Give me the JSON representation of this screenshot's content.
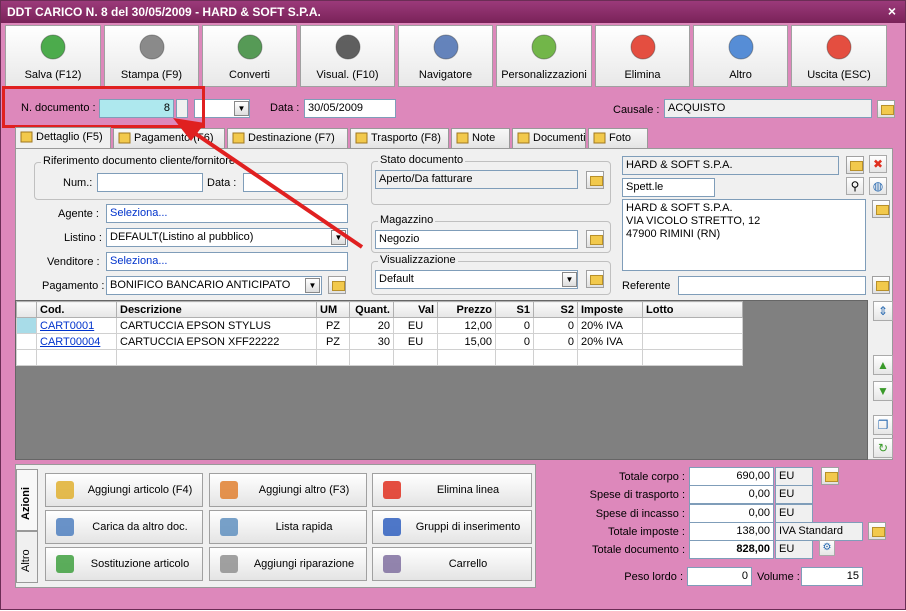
{
  "window": {
    "title": "DDT CARICO N. 8 del 30/05/2009 - HARD & SOFT S.P.A.",
    "close": "×"
  },
  "toolbar": [
    {
      "label": "Salva (F12)",
      "icon": "check-icon",
      "color": "#2e9e2e"
    },
    {
      "label": "Stampa (F9)",
      "icon": "printer-icon",
      "color": "#777777"
    },
    {
      "label": "Converti",
      "icon": "convert-icon",
      "color": "#3a8a3a"
    },
    {
      "label": "Visual. (F10)",
      "icon": "magic-wand-icon",
      "color": "#444444"
    },
    {
      "label": "Navigatore",
      "icon": "compass-icon",
      "color": "#4a6fb0"
    },
    {
      "label": "Personalizzazioni",
      "icon": "puzzle-icon",
      "color": "#5aaa2a"
    },
    {
      "label": "Elimina",
      "icon": "delete-x-icon",
      "color": "#e03020"
    },
    {
      "label": "Altro",
      "icon": "magnifier-icon",
      "color": "#3a7ad0"
    },
    {
      "label": "Uscita (ESC)",
      "icon": "power-icon",
      "color": "#e03020"
    }
  ],
  "header": {
    "ndoc_label": "N. documento :",
    "ndoc_value": "8",
    "data_label": "Data :",
    "data_value": "30/05/2009",
    "causale_label": "Causale :",
    "causale_value": "ACQUISTO"
  },
  "tabs": [
    "Dettaglio (F5)",
    "Pagamento (F6)",
    "Destinazione (F7)",
    "Trasporto (F8)",
    "Note",
    "Documenti",
    "Foto"
  ],
  "riferimento": {
    "title": "Riferimento documento cliente/fornitore",
    "num_label": "Num.:",
    "data_label": "Data :"
  },
  "agente": {
    "label": "Agente :",
    "value": "Seleziona..."
  },
  "listino": {
    "label": "Listino :",
    "value": "DEFAULT(Listino al pubblico)"
  },
  "venditore": {
    "label": "Venditore :",
    "value": "Seleziona..."
  },
  "pagamento": {
    "label": "Pagamento :",
    "value": "BONIFICO BANCARIO ANTICIPATO"
  },
  "stato": {
    "title": "Stato documento",
    "value": "Aperto/Da fatturare"
  },
  "magazzino": {
    "title": "Magazzino",
    "value": "Negozio"
  },
  "visualizzazione": {
    "title": "Visualizzazione",
    "value": "Default"
  },
  "cliente": {
    "name": "HARD & SOFT S.P.A.",
    "salutation": "Spett.le",
    "address": [
      "HARD & SOFT S.P.A.",
      "VIA VICOLO STRETTO, 12",
      "47900 RIMINI (RN)"
    ],
    "referente_label": "Referente"
  },
  "grid": {
    "columns": [
      "Cod.",
      "Descrizione",
      "UM",
      "Quant.",
      "Val",
      "Prezzo",
      "S1",
      "S2",
      "Imposte",
      "Lotto"
    ],
    "rows": [
      [
        "CART0001",
        "CARTUCCIA EPSON STYLUS",
        "PZ",
        "20",
        "EU",
        "12,00",
        "0",
        "0",
        "20% IVA",
        ""
      ],
      [
        "CART00004",
        "CARTUCCIA EPSON XFF22222",
        "PZ",
        "30",
        "EU",
        "15,00",
        "0",
        "0",
        "20% IVA",
        ""
      ]
    ]
  },
  "actions": {
    "vtab_azioni": "Azioni",
    "vtab_altro": "Altro",
    "buttons": [
      "Aggiungi articolo (F4)",
      "Aggiungi altro (F3)",
      "Elimina linea",
      "Carica da altro doc.",
      "Lista rapida",
      "Gruppi di inserimento",
      "Sostituzione articolo",
      "Aggiungi riparazione",
      "Carrello"
    ]
  },
  "totals": {
    "corpo_label": "Totale corpo :",
    "corpo": "690,00",
    "corpo_cur": "EU",
    "trasporto_label": "Spese di trasporto :",
    "trasporto": "0,00",
    "trasporto_cur": "EU",
    "incasso_label": "Spese di incasso :",
    "incasso": "0,00",
    "incasso_cur": "EU",
    "imposte_label": "Totale imposte :",
    "imposte": "138,00",
    "imposte_cur": "IVA Standard",
    "documento_label": "Totale documento :",
    "documento": "828,00",
    "documento_cur": "EU",
    "peso_label": "Peso lordo :",
    "peso": "0",
    "volume_label": "Volume :",
    "volume": "15"
  }
}
